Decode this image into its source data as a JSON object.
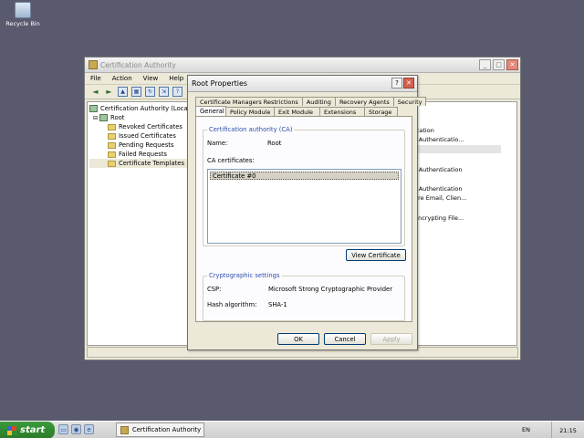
{
  "desktop": {
    "recycle_bin_label": "Recycle Bin"
  },
  "mmc": {
    "title": "Certification Authority",
    "menu": [
      "File",
      "Action",
      "View",
      "Help"
    ],
    "tree": {
      "root_label": "Certification Authority (Local)",
      "ca_label": "Root",
      "children": [
        "Revoked Certificates",
        "Issued Certificates",
        "Pending Requests",
        "Failed Requests",
        "Certificate Templates"
      ]
    },
    "right_items": [
      "ication",
      "r Authenticatio...",
      "r Authentication",
      "r Authentication",
      "ure Email, Clien...",
      "Encrypting File..."
    ]
  },
  "dialog": {
    "title": "Root Properties",
    "tabs_back": [
      "Certificate Managers Restrictions",
      "Auditing",
      "Recovery Agents",
      "Security"
    ],
    "tabs_front": [
      "General",
      "Policy Module",
      "Exit Module",
      "Extensions",
      "Storage"
    ],
    "ca_group": {
      "legend": "Certification authority (CA)",
      "name_label": "Name:",
      "name_value": "Root",
      "certs_label": "CA certificates:",
      "certs": [
        "Certificate #0"
      ],
      "view_cert_button": "View Certificate"
    },
    "crypto_group": {
      "legend": "Cryptographic settings",
      "csp_label": "CSP:",
      "csp_value": "Microsoft Strong Cryptographic Provider",
      "hash_label": "Hash algorithm:",
      "hash_value": "SHA-1"
    },
    "buttons": {
      "ok": "OK",
      "cancel": "Cancel",
      "apply": "Apply"
    }
  },
  "taskbar": {
    "start_label": "start",
    "task_label": "Certification Authority",
    "lang": "EN",
    "clock": "21:15"
  }
}
